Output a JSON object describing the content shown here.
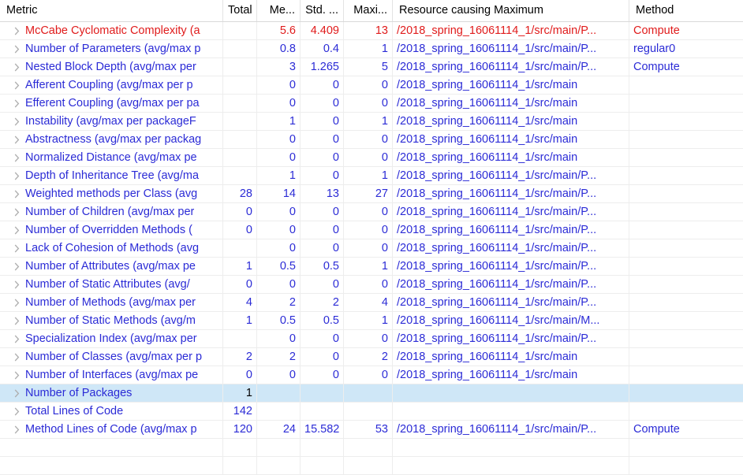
{
  "table": {
    "columns": [
      {
        "key": "metric",
        "label": "Metric"
      },
      {
        "key": "total",
        "label": "Total"
      },
      {
        "key": "mean",
        "label": "Me..."
      },
      {
        "key": "std",
        "label": "Std. ..."
      },
      {
        "key": "max",
        "label": "Maxi..."
      },
      {
        "key": "resource",
        "label": "Resource causing Maximum"
      },
      {
        "key": "method",
        "label": "Method"
      }
    ],
    "colors": {
      "normal_text": "#2b2bd6",
      "alert_text": "#e01b1b",
      "header_text": "#000000",
      "selection_bg": "#cfe7f7",
      "grid_line": "#ededed",
      "twisty": "#aeaeae"
    },
    "twisty_icon": "chevron-right-icon",
    "rows": [
      {
        "metric": "McCabe Cyclomatic Complexity (a",
        "total": "",
        "mean": "5.6",
        "std": "4.409",
        "max": "13",
        "resource": "/2018_spring_16061114_1/src/main/P...",
        "method": "Compute",
        "state": "alert",
        "selected": false
      },
      {
        "metric": "Number of Parameters (avg/max p",
        "total": "",
        "mean": "0.8",
        "std": "0.4",
        "max": "1",
        "resource": "/2018_spring_16061114_1/src/main/P...",
        "method": "regular0",
        "state": "normal",
        "selected": false
      },
      {
        "metric": "Nested Block Depth (avg/max per",
        "total": "",
        "mean": "3",
        "std": "1.265",
        "max": "5",
        "resource": "/2018_spring_16061114_1/src/main/P...",
        "method": "Compute",
        "state": "normal",
        "selected": false
      },
      {
        "metric": "Afferent Coupling (avg/max per p",
        "total": "",
        "mean": "0",
        "std": "0",
        "max": "0",
        "resource": "/2018_spring_16061114_1/src/main",
        "method": "",
        "state": "normal",
        "selected": false
      },
      {
        "metric": "Efferent Coupling (avg/max per pa",
        "total": "",
        "mean": "0",
        "std": "0",
        "max": "0",
        "resource": "/2018_spring_16061114_1/src/main",
        "method": "",
        "state": "normal",
        "selected": false
      },
      {
        "metric": "Instability (avg/max per packageF",
        "total": "",
        "mean": "1",
        "std": "0",
        "max": "1",
        "resource": "/2018_spring_16061114_1/src/main",
        "method": "",
        "state": "normal",
        "selected": false
      },
      {
        "metric": "Abstractness (avg/max per packag",
        "total": "",
        "mean": "0",
        "std": "0",
        "max": "0",
        "resource": "/2018_spring_16061114_1/src/main",
        "method": "",
        "state": "normal",
        "selected": false
      },
      {
        "metric": "Normalized Distance (avg/max pe",
        "total": "",
        "mean": "0",
        "std": "0",
        "max": "0",
        "resource": "/2018_spring_16061114_1/src/main",
        "method": "",
        "state": "normal",
        "selected": false
      },
      {
        "metric": "Depth of Inheritance Tree (avg/ma",
        "total": "",
        "mean": "1",
        "std": "0",
        "max": "1",
        "resource": "/2018_spring_16061114_1/src/main/P...",
        "method": "",
        "state": "normal",
        "selected": false
      },
      {
        "metric": "Weighted methods per Class (avg",
        "total": "28",
        "mean": "14",
        "std": "13",
        "max": "27",
        "resource": "/2018_spring_16061114_1/src/main/P...",
        "method": "",
        "state": "normal",
        "selected": false
      },
      {
        "metric": "Number of Children (avg/max per",
        "total": "0",
        "mean": "0",
        "std": "0",
        "max": "0",
        "resource": "/2018_spring_16061114_1/src/main/P...",
        "method": "",
        "state": "normal",
        "selected": false
      },
      {
        "metric": "Number of Overridden Methods (",
        "total": "0",
        "mean": "0",
        "std": "0",
        "max": "0",
        "resource": "/2018_spring_16061114_1/src/main/P...",
        "method": "",
        "state": "normal",
        "selected": false
      },
      {
        "metric": "Lack of Cohesion of Methods (avg",
        "total": "",
        "mean": "0",
        "std": "0",
        "max": "0",
        "resource": "/2018_spring_16061114_1/src/main/P...",
        "method": "",
        "state": "normal",
        "selected": false
      },
      {
        "metric": "Number of Attributes (avg/max pe",
        "total": "1",
        "mean": "0.5",
        "std": "0.5",
        "max": "1",
        "resource": "/2018_spring_16061114_1/src/main/P...",
        "method": "",
        "state": "normal",
        "selected": false
      },
      {
        "metric": "Number of Static Attributes (avg/",
        "total": "0",
        "mean": "0",
        "std": "0",
        "max": "0",
        "resource": "/2018_spring_16061114_1/src/main/P...",
        "method": "",
        "state": "normal",
        "selected": false
      },
      {
        "metric": "Number of Methods (avg/max per",
        "total": "4",
        "mean": "2",
        "std": "2",
        "max": "4",
        "resource": "/2018_spring_16061114_1/src/main/P...",
        "method": "",
        "state": "normal",
        "selected": false
      },
      {
        "metric": "Number of Static Methods (avg/m",
        "total": "1",
        "mean": "0.5",
        "std": "0.5",
        "max": "1",
        "resource": "/2018_spring_16061114_1/src/main/M...",
        "method": "",
        "state": "normal",
        "selected": false
      },
      {
        "metric": "Specialization Index (avg/max per",
        "total": "",
        "mean": "0",
        "std": "0",
        "max": "0",
        "resource": "/2018_spring_16061114_1/src/main/P...",
        "method": "",
        "state": "normal",
        "selected": false
      },
      {
        "metric": "Number of Classes (avg/max per p",
        "total": "2",
        "mean": "2",
        "std": "0",
        "max": "2",
        "resource": "/2018_spring_16061114_1/src/main",
        "method": "",
        "state": "normal",
        "selected": false
      },
      {
        "metric": "Number of Interfaces (avg/max pe",
        "total": "0",
        "mean": "0",
        "std": "0",
        "max": "0",
        "resource": "/2018_spring_16061114_1/src/main",
        "method": "",
        "state": "normal",
        "selected": false
      },
      {
        "metric": "Number of Packages",
        "total": "1",
        "mean": "",
        "std": "",
        "max": "",
        "resource": "",
        "method": "",
        "state": "normal",
        "selected": true
      },
      {
        "metric": "Total Lines of Code",
        "total": "142",
        "mean": "",
        "std": "",
        "max": "",
        "resource": "",
        "method": "",
        "state": "normal",
        "selected": false
      },
      {
        "metric": "Method Lines of Code (avg/max p",
        "total": "120",
        "mean": "24",
        "std": "15.582",
        "max": "53",
        "resource": "/2018_spring_16061114_1/src/main/P...",
        "method": "Compute",
        "state": "normal",
        "selected": false
      },
      {
        "metric": "",
        "total": "",
        "mean": "",
        "std": "",
        "max": "",
        "resource": "",
        "method": "",
        "state": "empty",
        "selected": false
      },
      {
        "metric": "",
        "total": "",
        "mean": "",
        "std": "",
        "max": "",
        "resource": "",
        "method": "",
        "state": "empty",
        "selected": false
      }
    ]
  }
}
